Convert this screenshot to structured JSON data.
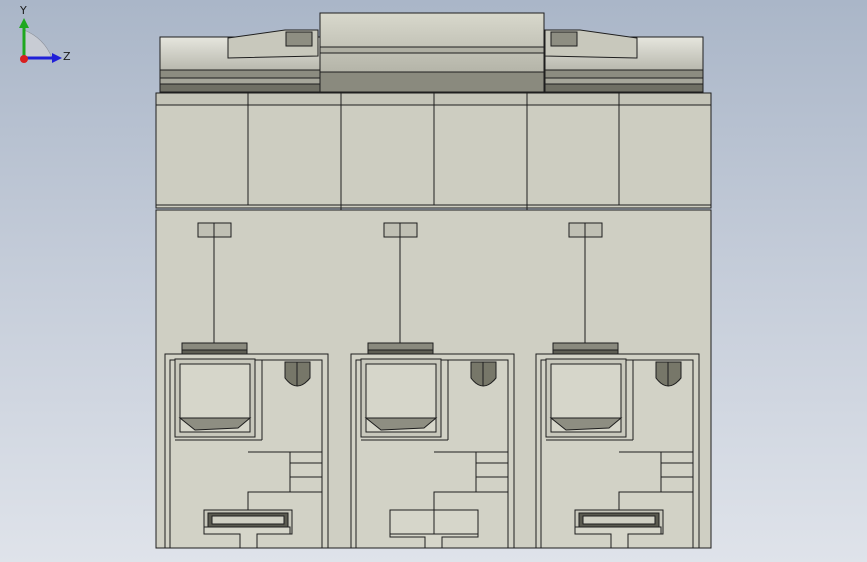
{
  "viewport": {
    "background_top": "#aab6c8",
    "background_bottom": "#dfe3ea",
    "model": {
      "body_color": "#cfcfc3",
      "edge_color": "#1e1e1e",
      "pole_count": 3
    }
  },
  "triad": {
    "x_label": "",
    "y_label": "Y",
    "z_label": "Z",
    "y_color": "#1fa81f",
    "z_color": "#2020d8",
    "origin_color": "#d81f1f"
  }
}
